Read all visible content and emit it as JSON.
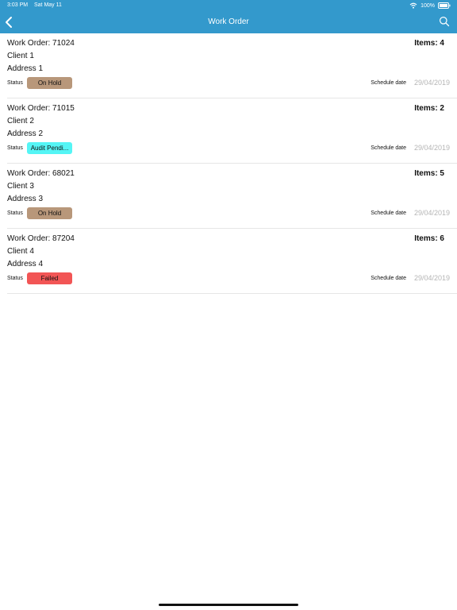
{
  "status_bar": {
    "time": "3:03 PM",
    "date": "Sat May 11",
    "battery": "100%"
  },
  "nav": {
    "title": "Work Order",
    "back_icon": "chevron-left-icon",
    "search_icon": "search-icon"
  },
  "colors": {
    "topbar": "#3399cc",
    "on_hold": "#b8977a",
    "audit_pending": "#55f5f5",
    "failed": "#f25555"
  },
  "work_orders": [
    {
      "title": "Work Order: 71024",
      "items": "Items: 4",
      "client": "Client 1",
      "address": "Address 1",
      "status_label": "Status",
      "status": "On Hold",
      "status_color": "#b8977a",
      "schedule_label": "Schedule date",
      "schedule_date": "29/04/2019"
    },
    {
      "title": "Work Order: 71015",
      "items": "Items: 2",
      "client": "Client 2",
      "address": "Address 2",
      "status_label": "Status",
      "status": "Audit Pendi...",
      "status_color": "#55f5f5",
      "schedule_label": "Schedule date",
      "schedule_date": "29/04/2019"
    },
    {
      "title": "Work Order: 68021",
      "items": "Items: 5",
      "client": "Client 3",
      "address": "Address 3",
      "status_label": "Status",
      "status": "On Hold",
      "status_color": "#b8977a",
      "schedule_label": "Schedule date",
      "schedule_date": "29/04/2019"
    },
    {
      "title": "Work Order: 87204",
      "items": "Items: 6",
      "client": "Client 4",
      "address": "Address 4",
      "status_label": "Status",
      "status": "Failed",
      "status_color": "#f25555",
      "schedule_label": "Schedule date",
      "schedule_date": "29/04/2019"
    }
  ]
}
